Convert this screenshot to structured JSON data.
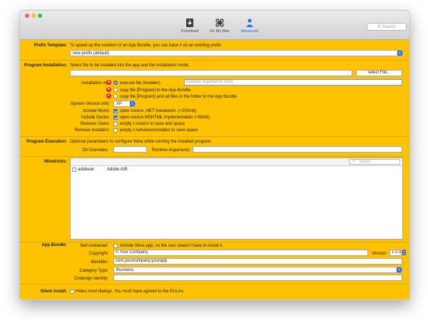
{
  "toolbar": {
    "download": "Download",
    "on_my_mac": "On My Mac",
    "advanced": "Advanced",
    "search_placeholder": "Search"
  },
  "prefix": {
    "label": "Prefix Template:",
    "description": "To speed up the creation of an App Bundle, you can base it on an existing prefix.",
    "selected": "new prefix (default)"
  },
  "program_installation": {
    "label": "Program Installation:",
    "description": "Select file to be installed into the app and the installation mode.",
    "select_file": "select File...",
    "mode_label": "Installation mod",
    "mode_execute": "execute file (installer)",
    "installer_args_placeholder": "Installer Arguments (opt)",
    "mode_copy_program": "copy file [Program]  to the App Bundle.",
    "mode_copy_all": "copy file [Program]  and all files in the folder to the App Bundle.",
    "markers": [
      "a",
      "b",
      "c"
    ],
    "system_version_label": "System Version Info:",
    "system_version_value": "XP",
    "mono_label": "Include Mono:",
    "mono_text": "open-source .NET framework. (≈200mb)",
    "gecko_label": "Include Gecko:",
    "gecko_text": "open-source MSHTML implementation (≈50mb)",
    "remove_users_label": "Remove Users:",
    "remove_users_text": "empty c:\\users\\ to save and space",
    "remove_installers_label": "Remove Installers:",
    "remove_installers_text": "empty c:\\windows\\installes to save space"
  },
  "program_execution": {
    "label": "Program Execution:",
    "description": "Optional parameters to configure Wine while running the installed program.",
    "dll_overrides": "Dll Overrides:",
    "runtime_arguments": "Runtime Arguments:"
  },
  "winetricks": {
    "label": "Winetricks:",
    "search_placeholder": "Search",
    "items": [
      {
        "name": "adobeair",
        "description": "Adobe AIR",
        "checked": false
      }
    ]
  },
  "app_bundle": {
    "label": "App Bundle:",
    "self_contained_label": "Self-contained:",
    "self_contained_text": "Include Wine.app, so the user doesn't have to install it.",
    "copyright_label": "Copyright:",
    "copyright_value": "© Your Company",
    "version_label": "Version:",
    "version_value": "1.0.0",
    "identifier_label": "Identifier:",
    "identifier_value": "com.yourcompany.yourapp",
    "category_label": "Category Type:",
    "category_value": "Business",
    "codesign_label": "Codesign Identity:"
  },
  "silent_install": {
    "label": "Silent install:",
    "text": "Hides most dialogs. You must have agreed to the EULAs."
  },
  "colors": {
    "background": "#fec200",
    "accent": "#2a6ae8",
    "marker": "#e0203a"
  }
}
